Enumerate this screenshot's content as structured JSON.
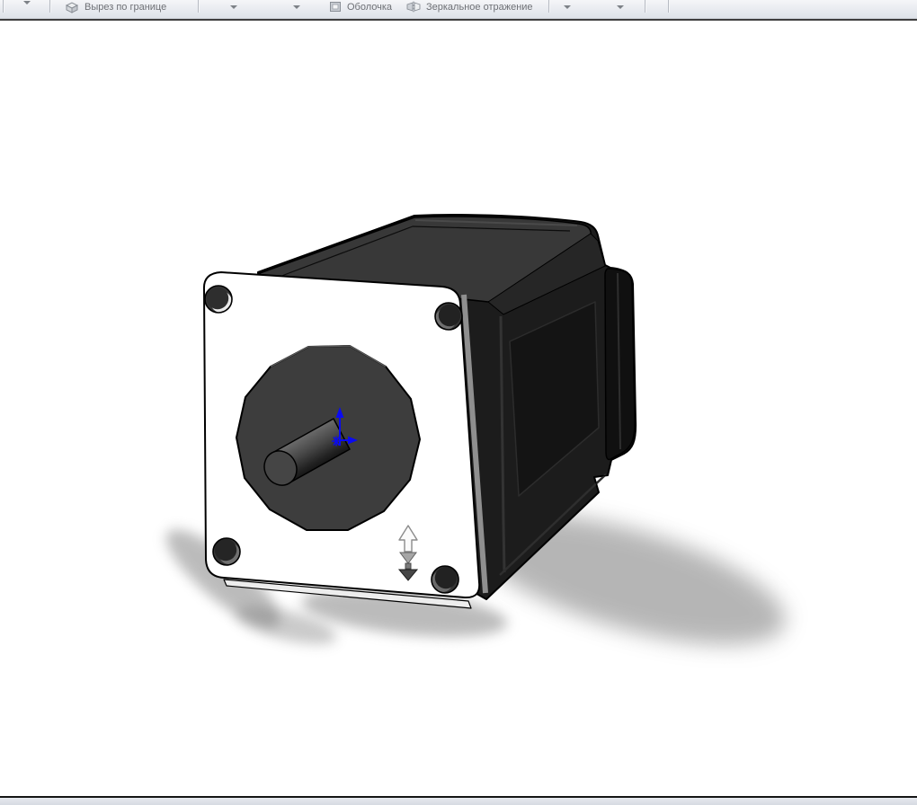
{
  "ribbon": {
    "buttons": [
      {
        "label": "Вырез по границе",
        "icon": "boundary-cut-icon",
        "enabled": false
      },
      {
        "label": "Оболочка",
        "icon": "shell-icon",
        "enabled": false
      },
      {
        "label": "Зеркальное отражение",
        "icon": "mirror-icon",
        "enabled": false
      }
    ]
  },
  "headsup_toolbar": {
    "buttons": [
      {
        "icon": "zoom-to-fit-icon",
        "enabled": true,
        "dropdown": false
      },
      {
        "icon": "zoom-to-area-icon",
        "enabled": true,
        "dropdown": false
      },
      {
        "icon": "previous-view-icon",
        "enabled": true,
        "dropdown": false
      },
      {
        "icon": "section-view-icon",
        "enabled": false,
        "dropdown": false
      },
      {
        "icon": "annotation-views-icon",
        "enabled": true,
        "dropdown": false
      },
      {
        "icon": "view-orientation-icon",
        "enabled": true,
        "dropdown": true
      },
      {
        "icon": "display-style-icon",
        "enabled": true,
        "dropdown": true
      },
      {
        "icon": "hide-show-items-icon",
        "enabled": true,
        "dropdown": true
      },
      {
        "icon": "edit-appearance-icon",
        "enabled": false,
        "dropdown": false
      },
      {
        "icon": "apply-scene-icon",
        "enabled": false,
        "dropdown": true
      },
      {
        "icon": "view-settings-icon",
        "enabled": true,
        "dropdown": true
      }
    ]
  },
  "viewport": {
    "content": "stepper-motor-3d-model",
    "annotations": {
      "origin_triad_color": "#0a0af2",
      "direction_manipulator": "double-arrow"
    },
    "colors": {
      "background": "#ffffff",
      "flange": "#ffffff",
      "boss": "#3d3d3d",
      "body_top": "#383838",
      "body_side": "#1c1c1c",
      "shadow": "#7a7a7a"
    }
  },
  "status_bar": {
    "text": ""
  }
}
